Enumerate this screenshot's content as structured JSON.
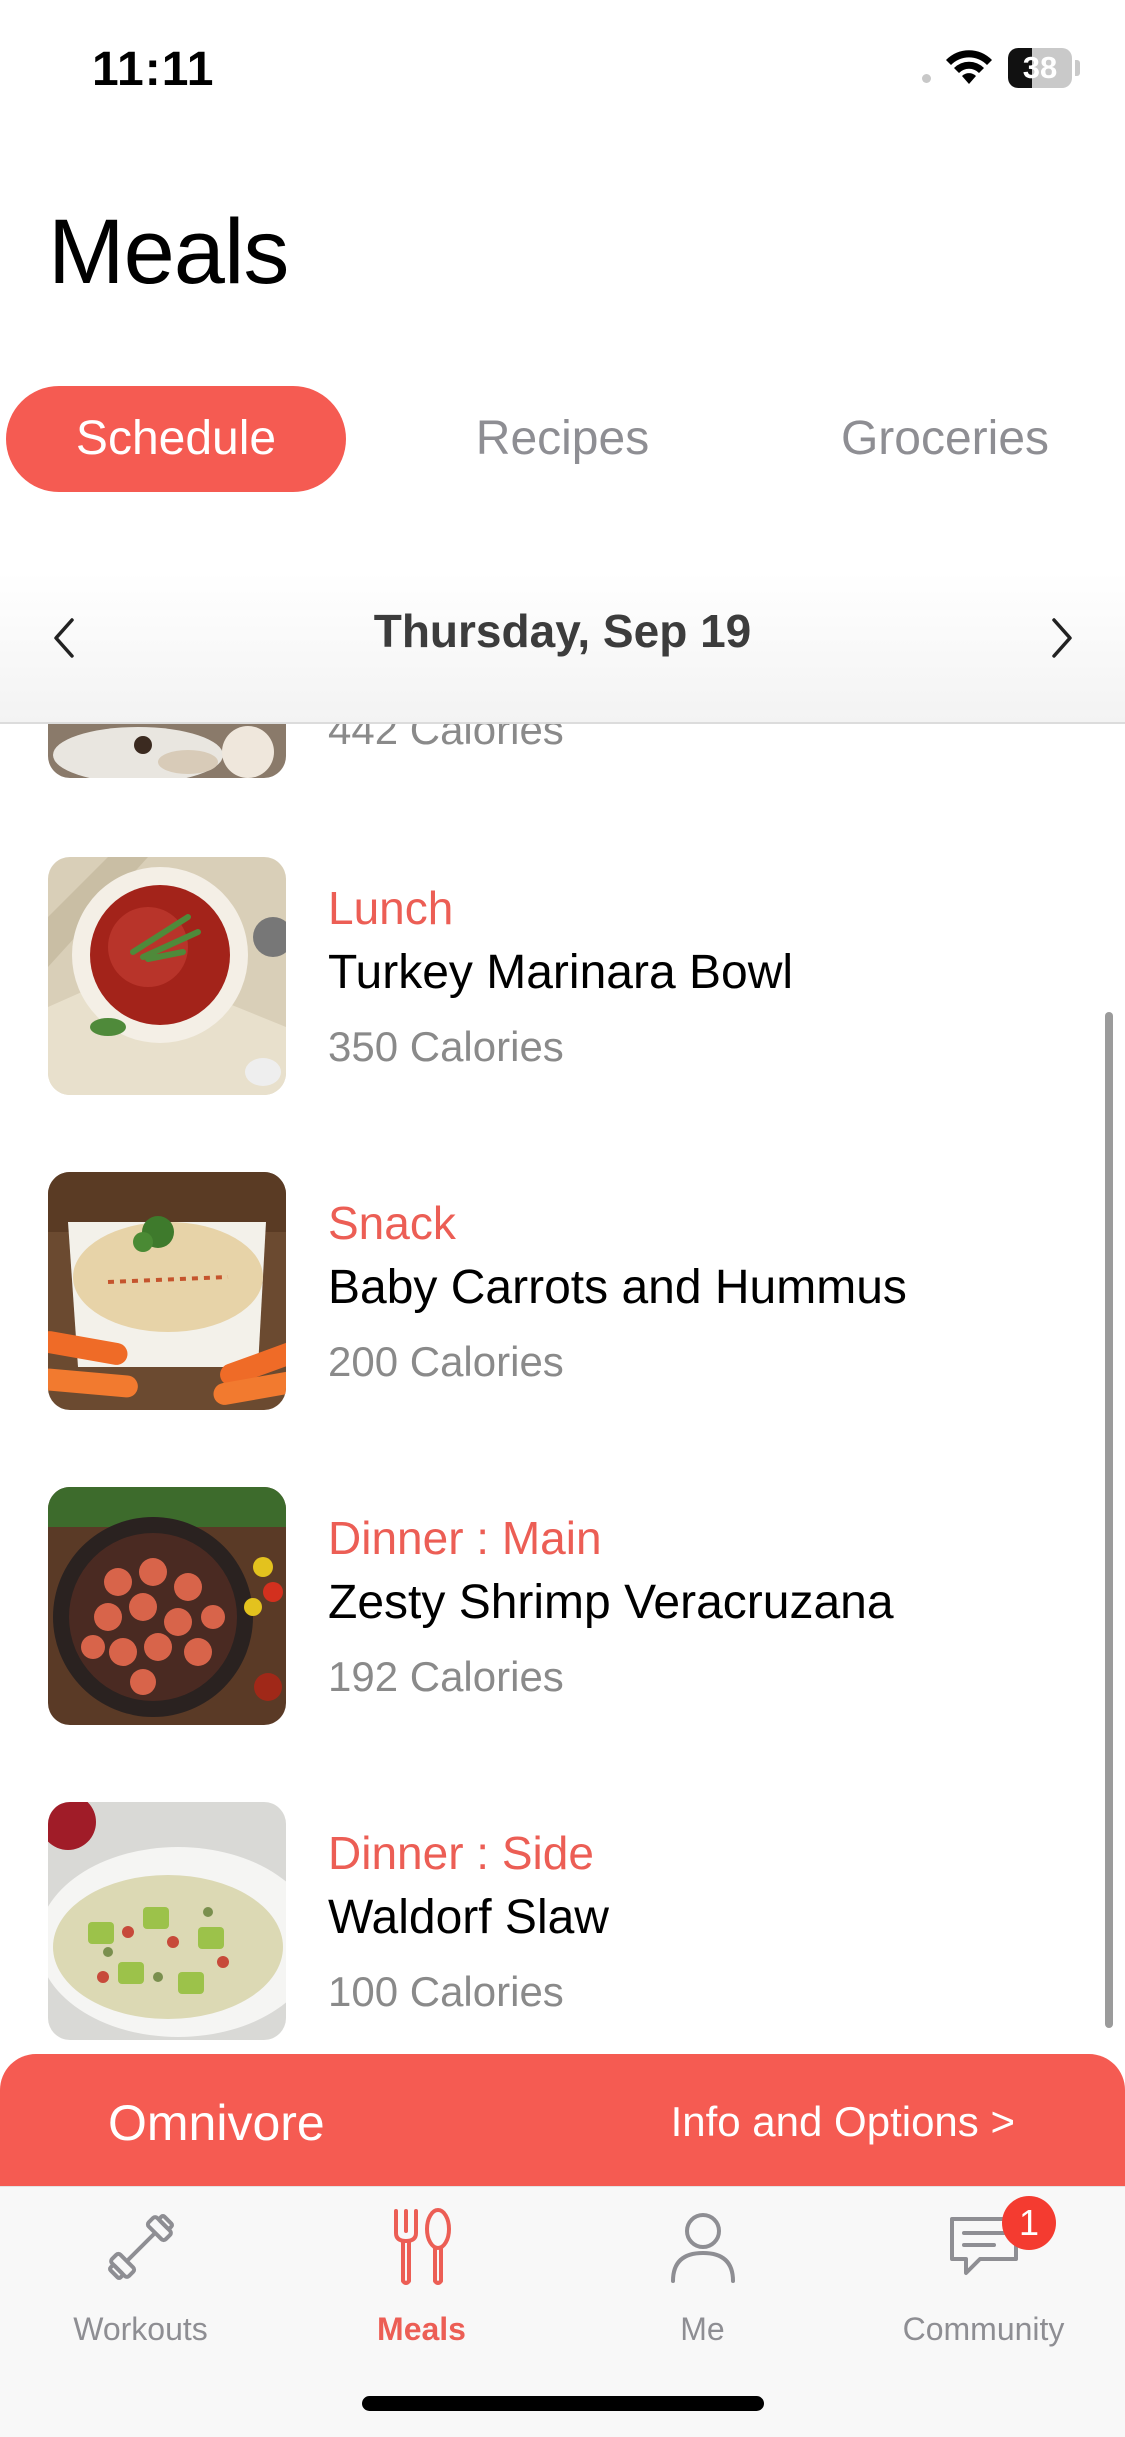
{
  "status_bar": {
    "time": "11:11",
    "battery": "38",
    "battery_level": 0.38
  },
  "header": {
    "title": "Meals"
  },
  "tabs": [
    {
      "label": "Schedule",
      "active": true
    },
    {
      "label": "Recipes",
      "active": false
    },
    {
      "label": "Groceries",
      "active": false
    }
  ],
  "date_nav": {
    "date": "Thursday, Sep 19",
    "prev_icon": "chevron-left-icon",
    "next_icon": "chevron-right-icon"
  },
  "meals": [
    {
      "type": "",
      "name": "",
      "calories": "442 Calories"
    },
    {
      "type": "Lunch",
      "name": "Turkey Marinara Bowl",
      "calories": "350 Calories"
    },
    {
      "type": "Snack",
      "name": "Baby Carrots and Hummus",
      "calories": "200 Calories"
    },
    {
      "type": "Dinner : Main",
      "name": "Zesty Shrimp Veracruzana",
      "calories": "192 Calories"
    },
    {
      "type": "Dinner : Side",
      "name": "Waldorf Slaw",
      "calories": "100 Calories"
    }
  ],
  "plan_banner": {
    "name": "Omnivore",
    "link": "Info and Options >"
  },
  "tab_bar": {
    "items": [
      {
        "label": "Workouts",
        "icon": "dumbbell-icon",
        "active": false
      },
      {
        "label": "Meals",
        "icon": "fork-knife-icon",
        "active": true
      },
      {
        "label": "Me",
        "icon": "person-icon",
        "active": false
      },
      {
        "label": "Community",
        "icon": "chat-bubble-icon",
        "active": false
      }
    ],
    "community_badge": "1"
  },
  "colors": {
    "accent": "#f55b52",
    "accent_text": "#ec5e55",
    "muted": "#8e8e93",
    "badge": "#f43b30"
  }
}
